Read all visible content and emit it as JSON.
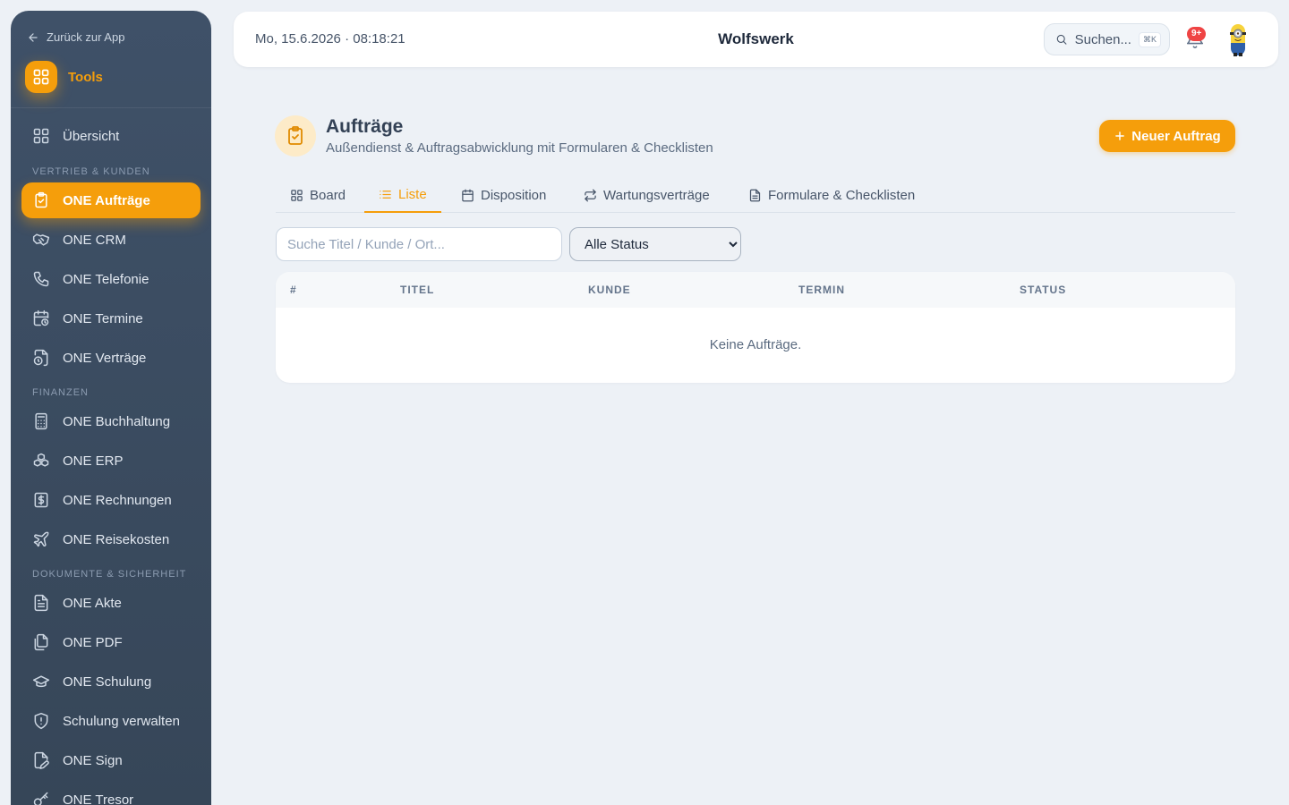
{
  "sidebar": {
    "back_label": "Zurück zur App",
    "tools_label": "Tools",
    "overview_label": "Übersicht",
    "sections": {
      "sales": "VERTRIEB & KUNDEN",
      "finance": "FINANZEN",
      "docs": "DOKUMENTE & SICHERHEIT"
    },
    "items": [
      {
        "label": "ONE Aufträge",
        "icon": "clipboard-check-icon",
        "active": true
      },
      {
        "label": "ONE CRM",
        "icon": "handshake-icon"
      },
      {
        "label": "ONE Telefonie",
        "icon": "phone-icon"
      },
      {
        "label": "ONE Termine",
        "icon": "calendar-clock-icon"
      },
      {
        "label": "ONE Verträge",
        "icon": "file-clock-icon"
      },
      {
        "label": "ONE Buchhaltung",
        "icon": "calculator-icon"
      },
      {
        "label": "ONE ERP",
        "icon": "boxes-icon"
      },
      {
        "label": "ONE Rechnungen",
        "icon": "receipt-dollar-icon"
      },
      {
        "label": "ONE Reisekosten",
        "icon": "plane-icon"
      },
      {
        "label": "ONE Akte",
        "icon": "file-text-icon"
      },
      {
        "label": "ONE PDF",
        "icon": "files-icon"
      },
      {
        "label": "ONE Schulung",
        "icon": "graduation-cap-icon"
      },
      {
        "label": "Schulung verwalten",
        "icon": "shield-alert-icon"
      },
      {
        "label": "ONE Sign",
        "icon": "file-signature-icon"
      },
      {
        "label": "ONE Tresor",
        "icon": "key-icon"
      }
    ]
  },
  "topbar": {
    "datetime": "Mo, 15.6.2026 · 08:18:21",
    "company": "Wolfswerk",
    "search_label": "Suchen...",
    "search_kbd": "⌘K",
    "notification_count": "9+"
  },
  "page": {
    "title": "Aufträge",
    "subtitle": "Außendienst & Auftragsabwicklung mit Formularen & Checklisten",
    "new_button": "Neuer Auftrag"
  },
  "tabs": [
    {
      "label": "Board",
      "icon": "grid-icon"
    },
    {
      "label": "Liste",
      "icon": "list-icon",
      "active": true
    },
    {
      "label": "Disposition",
      "icon": "calendar-icon"
    },
    {
      "label": "Wartungsverträge",
      "icon": "repeat-icon"
    },
    {
      "label": "Formulare & Checklisten",
      "icon": "file-text-icon"
    }
  ],
  "filters": {
    "search_placeholder": "Suche Titel / Kunde / Ort...",
    "status_selected": "Alle Status"
  },
  "table": {
    "columns": [
      "#",
      "TITEL",
      "KUNDE",
      "TERMIN",
      "STATUS"
    ],
    "empty_text": "Keine Aufträge."
  },
  "colors": {
    "accent": "#f59e0b",
    "sidebar": "#3a4a5f",
    "background": "#edf1f6",
    "badge": "#ef4444"
  }
}
